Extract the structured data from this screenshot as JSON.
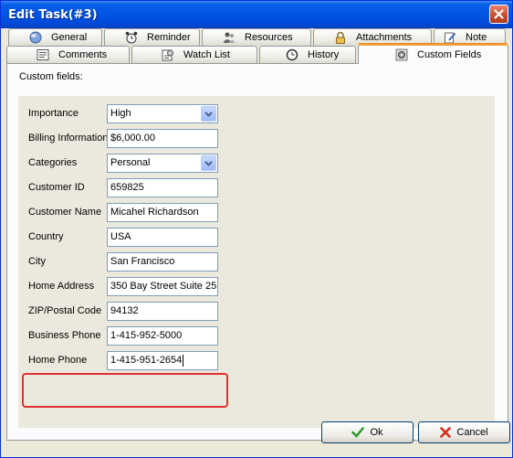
{
  "window": {
    "title": "Edit Task(#3)"
  },
  "tabs_row1": [
    {
      "label": "General",
      "icon": "globe-icon"
    },
    {
      "label": "Reminder",
      "icon": "alarm-clock-icon"
    },
    {
      "label": "Resources",
      "icon": "users-icon"
    },
    {
      "label": "Attachments",
      "icon": "lock-icon"
    },
    {
      "label": "Note",
      "icon": "note-pencil-icon"
    }
  ],
  "tabs_row2": [
    {
      "label": "Comments",
      "icon": "comments-icon"
    },
    {
      "label": "Watch List",
      "icon": "watch-list-icon"
    },
    {
      "label": "History",
      "icon": "history-icon"
    },
    {
      "label": "Custom Fields",
      "icon": "gear-icon",
      "active": true
    }
  ],
  "custom_fields": {
    "heading": "Custom fields:",
    "fields": [
      {
        "label": "Importance",
        "value": "High",
        "type": "dropdown"
      },
      {
        "label": "Billing Information",
        "value": "$6,000.00",
        "type": "text"
      },
      {
        "label": "Categories",
        "value": "Personal",
        "type": "dropdown"
      },
      {
        "label": "Customer ID",
        "value": "659825",
        "type": "text"
      },
      {
        "label": "Customer Name",
        "value": "Micahel Richardson",
        "type": "text"
      },
      {
        "label": "Country",
        "value": "USA",
        "type": "text"
      },
      {
        "label": "City",
        "value": "San Francisco",
        "type": "text"
      },
      {
        "label": "Home Address",
        "value": "350 Bay Street Suite 25",
        "type": "text"
      },
      {
        "label": "ZIP/Postal Code",
        "value": "94132",
        "type": "text"
      },
      {
        "label": "Business Phone",
        "value": "1-415-952-5000",
        "type": "text"
      },
      {
        "label": "Home Phone",
        "value": "1-415-951-2654",
        "type": "text",
        "focused": true
      }
    ]
  },
  "buttons": {
    "ok": "Ok",
    "cancel": "Cancel"
  },
  "colors": {
    "title_bar": "#0054e3",
    "active_tab_accent": "#f8a33a",
    "highlight": "#e03131"
  }
}
